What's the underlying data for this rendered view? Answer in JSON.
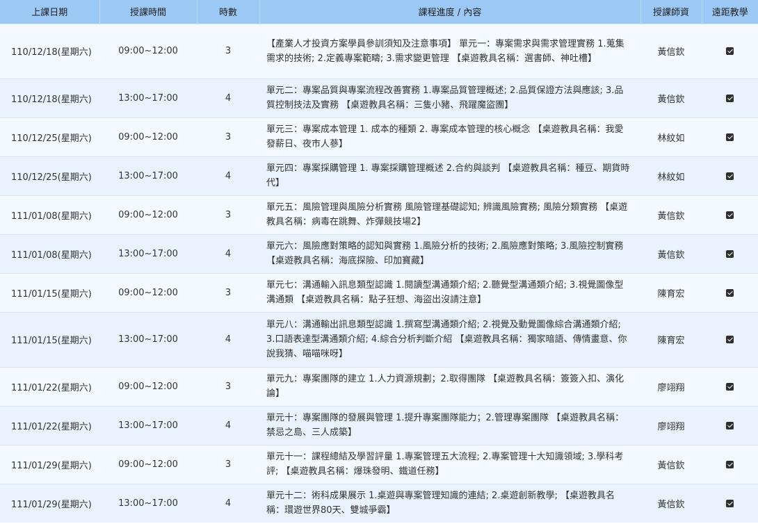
{
  "headers": {
    "date": "上課日期",
    "time": "授課時間",
    "hours": "時數",
    "content": "課程進度 / 內容",
    "teacher": "授課師資",
    "remote": "遠距教學"
  },
  "rows": [
    {
      "date": "110/12/18(星期六)",
      "time": "09:00~12:00",
      "hours": "3",
      "content": "【產業人才投資方案學員參訓須知及注意事項】 單元一：專案需求與需求管理實務 1.蒐集需求的技術; 2.定義專案範疇; 3.需求變更管理 【桌遊教具名稱：選書師、神吐槽】",
      "teacher": "黃信欽",
      "remote": true
    },
    {
      "date": "110/12/18(星期六)",
      "time": "13:00~17:00",
      "hours": "4",
      "content": "單元二：專案品質與專案流程改善實務 1.專案品質管理概述; 2.品質保證方法與應該; 3.品質控制技法及實務 【桌遊教具名稱：三隻小豬、飛躍魔盜團】",
      "teacher": "黃信欽",
      "remote": true
    },
    {
      "date": "110/12/25(星期六)",
      "time": "09:00~12:00",
      "hours": "3",
      "content": "單元三：專案成本管理 1. 成本的種類 2. 專案成本管理的核心概念 【桌遊教具名稱：我愛發薪日、夜市人蔘】",
      "teacher": "林紋如",
      "remote": true
    },
    {
      "date": "110/12/25(星期六)",
      "time": "13:00~17:00",
      "hours": "4",
      "content": "單元四：專案採購管理 1. 專案採購管理概述 2.合約與談判 【桌遊教具名稱：種豆、期貨時代】",
      "teacher": "林紋如",
      "remote": true
    },
    {
      "date": "111/01/08(星期六)",
      "time": "09:00~12:00",
      "hours": "3",
      "content": "單元五：風險管理與風險分析實務 風險管理基礎認知; 辨識風險實務; 風險分類實務 【桌遊教具名稱：病毒在跳舞、炸彈競技場2】",
      "teacher": "黃信欽",
      "remote": true
    },
    {
      "date": "111/01/08(星期六)",
      "time": "13:00~17:00",
      "hours": "4",
      "content": "單元六：風險應對策略的認知與實務 1.風險分析的技術; 2.風險應對策略; 3.風險控制實務 【桌遊教具名稱：海底探險、印加寶藏】",
      "teacher": "黃信欽",
      "remote": true
    },
    {
      "date": "111/01/15(星期六)",
      "time": "09:00~12:00",
      "hours": "3",
      "content": "單元七：溝通輸入訊息類型認識 1.閱讀型溝通類介紹; 2.聽覺型溝通類介紹; 3.視覺圖像型溝通類 【桌遊教具名稱：點子狂想、海盜出沒請注意】",
      "teacher": "陳育宏",
      "remote": true
    },
    {
      "date": "111/01/15(星期六)",
      "time": "13:00~17:00",
      "hours": "4",
      "content": "單元八：溝通輸出訊息類型認識 1.撰寫型溝通類介紹; 2.視覺及動覺圖像綜合溝通類介紹; 3.口語表達型溝通類介紹; 4.綜合分析判斷介紹 【桌遊教具名稱：獨家暗語、傳情畫意、你說我猜、喵喵咪呀】",
      "teacher": "陳育宏",
      "remote": true
    },
    {
      "date": "111/01/22(星期六)",
      "time": "09:00~12:00",
      "hours": "3",
      "content": "單元九：專案團隊的建立 1.人力資源規劃；2.取得團隊 【桌遊教具名稱：簽簽入扣、演化論】",
      "teacher": "廖翊翔",
      "remote": true
    },
    {
      "date": "111/01/22(星期六)",
      "time": "13:00~17:00",
      "hours": "4",
      "content": "單元十：專案團隊的發展與管理 1.提升專案團隊能力；2.管理專案團隊 【桌遊教具名稱：禁忌之島、三人成築】",
      "teacher": "廖翊翔",
      "remote": true
    },
    {
      "date": "111/01/29(星期六)",
      "time": "09:00~12:00",
      "hours": "3",
      "content": "單元十一：課程總結及學習評量 1.專案管理五大流程; 2.專案管理十大知識領域; 3.學科考評; 【桌遊教具名稱：爆珠發明、鐵道任務】",
      "teacher": "黃信欽",
      "remote": true
    },
    {
      "date": "111/01/29(星期六)",
      "time": "13:00~17:00",
      "hours": "4",
      "content": "單元十二：術科成果展示 1.桌遊與專案管理知識的連結; 2.桌遊創新教學; 【桌遊教具名稱：環遊世界80天、雙城爭霸】",
      "teacher": "黃信欽",
      "remote": true
    }
  ]
}
